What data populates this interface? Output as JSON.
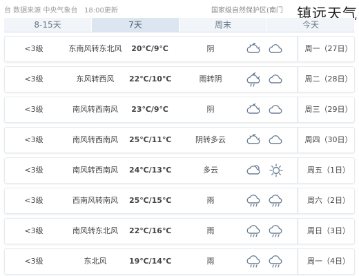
{
  "topbar": {
    "source": "台 数据来源 中央气象台",
    "time": "18:00更新",
    "location": "国家级自然保护区(南门"
  },
  "watermark": "镇远天气",
  "tabs": [
    {
      "label": "8-15天",
      "active": false
    },
    {
      "label": "7天",
      "active": true
    },
    {
      "label": "周末",
      "active": false
    },
    {
      "label": "今天",
      "active": false
    }
  ],
  "forecast": [
    {
      "day": "周一（27日）",
      "icons": [
        "night-cloudy-icon",
        "cloud-icon"
      ],
      "desc": "阴",
      "temp": "20℃/9℃",
      "wind": "东南风转东北风",
      "level": "<3级"
    },
    {
      "day": "周二（28日）",
      "icons": [
        "night-rain-icon",
        "cloud-icon"
      ],
      "desc": "雨转阴",
      "temp": "22℃/10℃",
      "wind": "东风转西风",
      "level": "<3级"
    },
    {
      "day": "周三（29日）",
      "icons": [
        "night-cloudy-icon",
        "cloud-icon"
      ],
      "desc": "阴",
      "temp": "23℃/9℃",
      "wind": "南风转西南风",
      "level": "<3级"
    },
    {
      "day": "周四（30日）",
      "icons": [
        "night-cloudy-icon",
        "cloud-icon"
      ],
      "desc": "阴转多云",
      "temp": "25℃/11℃",
      "wind": "南风转西南风",
      "level": "<3级"
    },
    {
      "day": "周五（1日）",
      "icons": [
        "partly-cloudy-icon",
        "sun-icon"
      ],
      "desc": "多云",
      "temp": "24℃/13℃",
      "wind": "南风转西南风",
      "level": "<3级"
    },
    {
      "day": "周六（2日）",
      "icons": [
        "rain-icon",
        "rain-icon"
      ],
      "desc": "雨",
      "temp": "25℃/15℃",
      "wind": "西南风转南风",
      "level": "<3级"
    },
    {
      "day": "周日（3日）",
      "icons": [
        "rain-icon",
        "rain-icon"
      ],
      "desc": "雨",
      "temp": "22℃/16℃",
      "wind": "南风转东北风",
      "level": "<3级"
    },
    {
      "day": "周一（4日）",
      "icons": [
        "rain-icon",
        "rain-icon"
      ],
      "desc": "雨",
      "temp": "19℃/14℃",
      "wind": "东北风",
      "level": "<3级"
    }
  ],
  "colors": {
    "temp": "#e49a00",
    "icon_stroke": "#6b7f96",
    "tab_active_bg": "#dbe6f0",
    "tab_bg": "#f1f5f9"
  }
}
